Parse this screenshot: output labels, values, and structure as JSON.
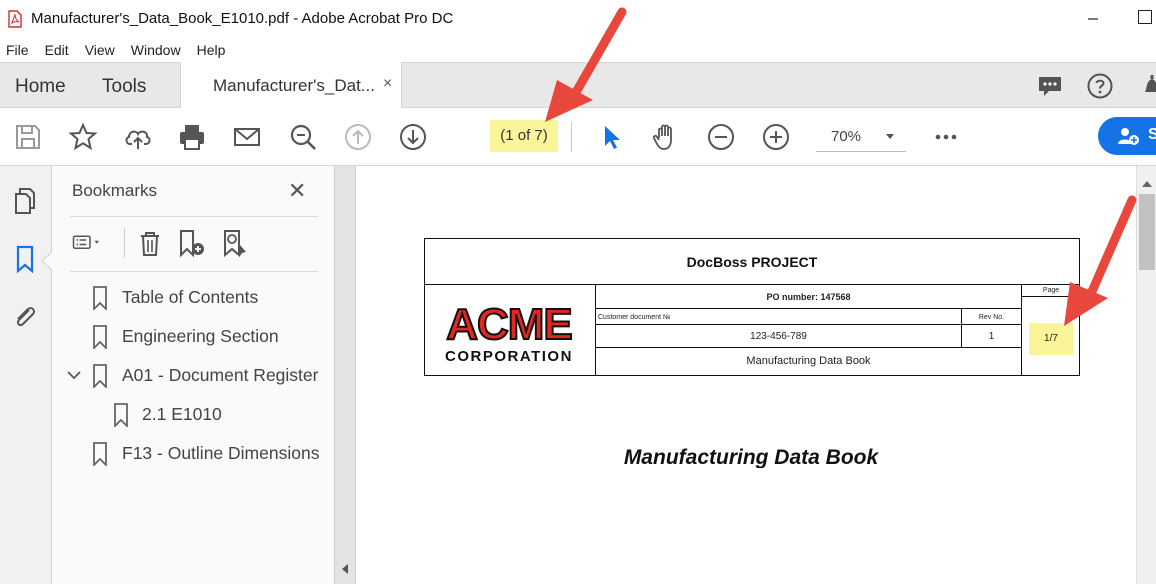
{
  "window": {
    "title": "Manufacturer's_Data_Book_E1010.pdf - Adobe Acrobat Pro DC",
    "icon": "pdf-icon"
  },
  "menu": [
    "File",
    "Edit",
    "View",
    "Window",
    "Help"
  ],
  "tabs": {
    "home": "Home",
    "tools": "Tools",
    "document": "Manufacturer's_Dat...",
    "close": "×"
  },
  "tab_icons": [
    "comment-icon",
    "help-icon",
    "bell-icon"
  ],
  "toolbar": {
    "icons": [
      "save-icon",
      "bookmark-star-icon",
      "upload-cloud-icon",
      "print-icon",
      "email-icon",
      "search-zoom-icon",
      "previous-page-icon",
      "next-page-icon"
    ],
    "page_indicator": "(1 of 7)",
    "zoom": "70%",
    "share_label": "S",
    "accent": "#1473e6",
    "highlight": "#fbf59a"
  },
  "rail_icons": [
    "pages-icon",
    "bookmarks-icon",
    "attachments-icon"
  ],
  "bookmarks_panel": {
    "title": "Bookmarks",
    "close": "✕",
    "items": [
      {
        "label": "Table of Contents",
        "indent": 0,
        "expander": false
      },
      {
        "label": "Engineering Section",
        "indent": 0,
        "expander": false
      },
      {
        "label": "A01 - Document Register",
        "indent": 0,
        "expander": true
      },
      {
        "label": "2.1 E1010",
        "indent": 1,
        "expander": false
      },
      {
        "label": "F13 - Outline Dimensions",
        "indent": 0,
        "expander": false
      }
    ]
  },
  "document": {
    "project": "DocBoss PROJECT",
    "logo_top": "ACME",
    "logo_bottom": "CORPORATION",
    "po_number": "PO number: 147568",
    "customer_doc_label": "Customer document №",
    "customer_doc_value": "123-456-789",
    "rev_label": "Rev No.",
    "rev_value": "1",
    "page_label": "Page",
    "page_value": "1/7",
    "book_label": "Manufacturing Data Book",
    "main_title": "Manufacturing Data Book"
  },
  "annotation_color": "#e8483b"
}
